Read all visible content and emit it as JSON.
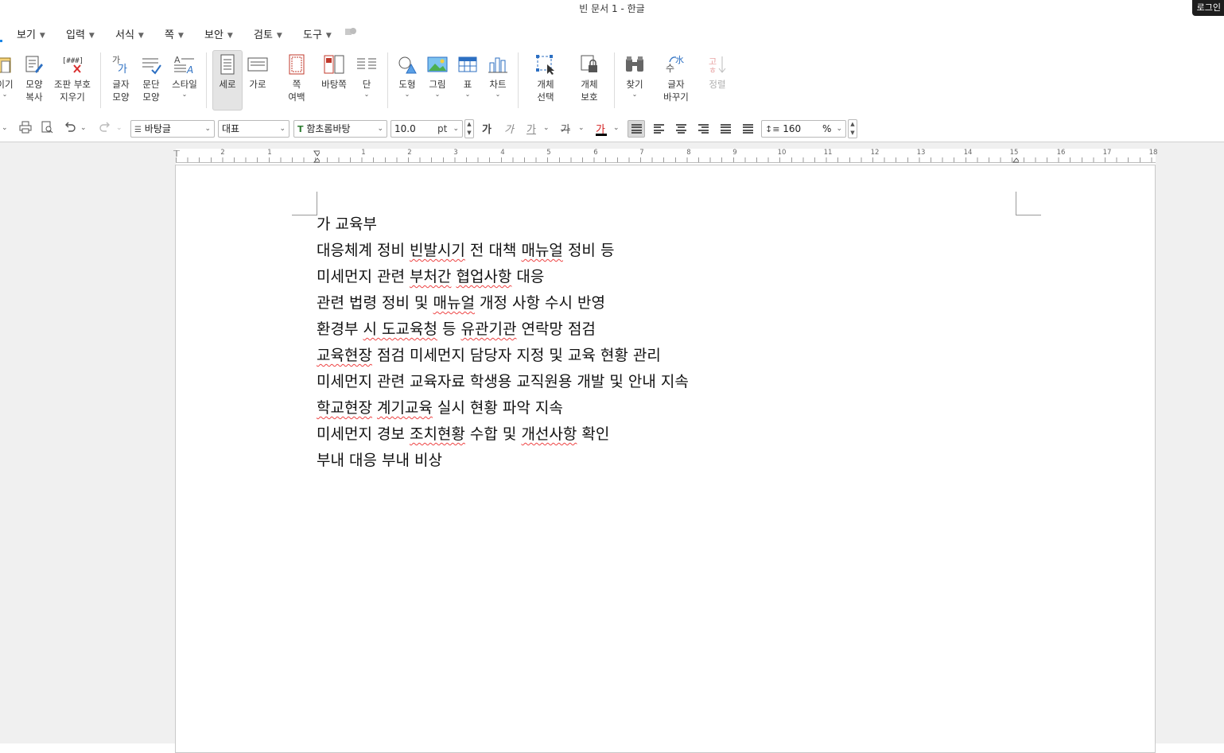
{
  "window": {
    "title": "빈 문서 1 - 한글",
    "login_label": "로그인"
  },
  "menu": {
    "items": [
      {
        "label": "보기"
      },
      {
        "label": "입력"
      },
      {
        "label": "서식"
      },
      {
        "label": "쪽"
      },
      {
        "label": "보안"
      },
      {
        "label": "검토"
      },
      {
        "label": "도구"
      }
    ]
  },
  "ribbon": {
    "partial_label": "이기",
    "shape_copy": "모양\n복사",
    "clear_mark": "조판 부호\n지우기",
    "char_shape": "글자\n모양",
    "para_shape": "문단\n모양",
    "style": "스타일",
    "vertical": "세로",
    "horizontal": "가로",
    "page_margin": "쪽\n여백",
    "page_bg": "바탕쪽",
    "column": "단",
    "shape": "도형",
    "picture": "그림",
    "table": "표",
    "chart": "차트",
    "obj_select": "개체\n선택",
    "obj_protect": "개체\n보호",
    "find": "찾기",
    "replace": "글자\n바꾸기",
    "sort": "정렬"
  },
  "format": {
    "style": "바탕글",
    "lang": "대표",
    "font": "함초롬바탕",
    "size": "10.0",
    "unit": "pt",
    "bold": "가",
    "italic": "가",
    "underline": "가",
    "strike": "가",
    "color_glyph": "가",
    "line_spacing": "160",
    "line_unit": "%",
    "text_color": "#d32020"
  },
  "ruler": {
    "labels": [
      "2",
      "1",
      "1",
      "2",
      "3",
      "4",
      "5",
      "6",
      "7",
      "8",
      "9",
      "10",
      "11",
      "12",
      "13",
      "14",
      "15",
      "16",
      "17",
      "18"
    ]
  },
  "document": {
    "lines": [
      "가 교육부",
      "대응체계 정비 빈발시기 전 대책 매뉴얼 정비 등",
      "미세먼지 관련 부처간 협업사항 대응",
      "관련 법령 정비 및 매뉴얼 개정 사항 수시 반영",
      "환경부 시 도교육청 등 유관기관 연락망 점검",
      "교육현장 점검 미세먼지 담당자 지정 및 교육 현황 관리",
      "미세먼지 관련 교육자료 학생용 교직원용 개발 및 안내 지속",
      "학교현장 계기교육 실시 현황 파악 지속",
      "미세먼지 경보 조치현황 수합 및 개선사항 확인",
      "부내 대응 부내 비상"
    ]
  }
}
